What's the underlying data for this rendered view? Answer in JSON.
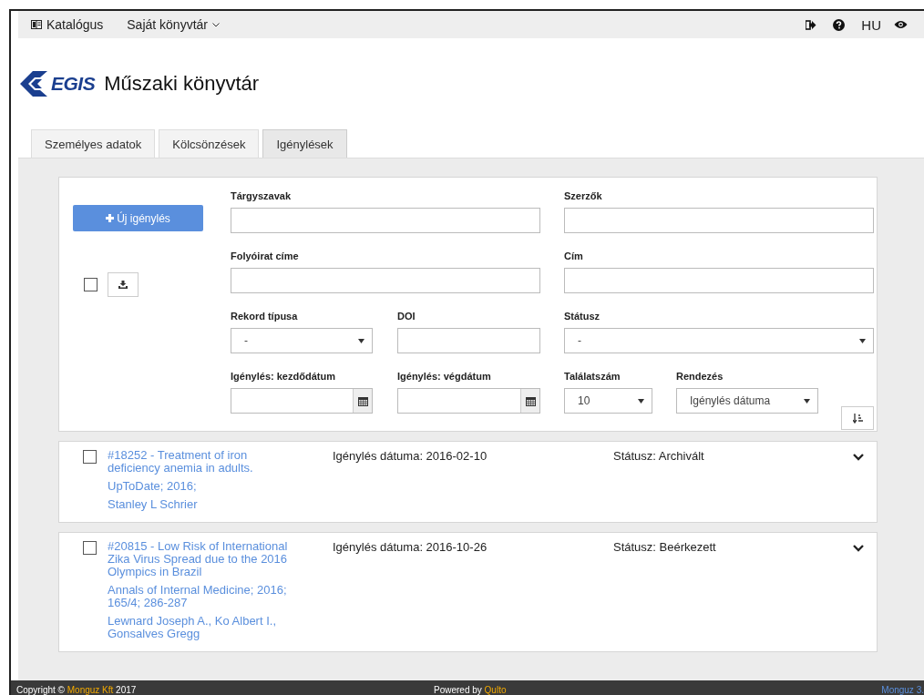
{
  "top_nav": {
    "items": [
      {
        "label": "Katalógus",
        "kind": "catalog"
      },
      {
        "label": "Saját könyvtár",
        "kind": "dropdown"
      }
    ],
    "language": "HU"
  },
  "header": {
    "logo_text": "EGIS",
    "title": "Műszaki könyvtár"
  },
  "tabs": [
    {
      "label": "Személyes adatok",
      "selected": false
    },
    {
      "label": "Kölcsönzések",
      "selected": false
    },
    {
      "label": "Igénylések",
      "selected": true
    }
  ],
  "filters": {
    "new_button": "Új igénylés",
    "select_all_checked": false,
    "fields": [
      {
        "label": "Tárgyszavak",
        "kind": "text"
      },
      {
        "label": "Szerzők",
        "kind": "text"
      },
      {
        "label": "Folyóirat címe",
        "kind": "text"
      },
      {
        "label": "Cím",
        "kind": "text"
      },
      {
        "label": "Rekord típusa",
        "kind": "select",
        "value": "-"
      },
      {
        "label": "DOI",
        "kind": "text"
      },
      {
        "label": "Státusz",
        "kind": "select",
        "value": "-"
      },
      {
        "label": "Igénylés: kezdődátum",
        "kind": "date"
      },
      {
        "label": "Igénylés: végdátum",
        "kind": "date"
      },
      {
        "label": "Találatszám",
        "kind": "select",
        "value": "10"
      },
      {
        "label": "Rendezés",
        "kind": "select",
        "value": "Igénylés dátuma"
      }
    ]
  },
  "results": [
    {
      "checked": false,
      "title": "#18252 - Treatment of iron deficiency anemia in adults.",
      "source": "UpToDate; 2016;",
      "authors": "Stanley L Schrier",
      "date": "Igénylés dátuma: 2016-02-10",
      "status": "Státusz: Archivált"
    },
    {
      "checked": false,
      "title": "#20815 - Low Risk of International Zika Virus Spread due to the 2016 Olympics in Brazil",
      "source": "Annals of Internal Medicine; 2016; 165/4; 286-287",
      "authors": "Lewnard Joseph A., Ko Albert I., Gonsalves Gregg",
      "date": "Igénylés dátuma: 2016-10-26",
      "status": "Státusz: Beérkezett"
    }
  ],
  "footer": {
    "copyright_prefix": "Copyright ©",
    "company": "Monguz Kft",
    "year": "2017",
    "powered_prefix": "Powered by",
    "powered_link": "Qulto",
    "version": "Monguz 3."
  }
}
